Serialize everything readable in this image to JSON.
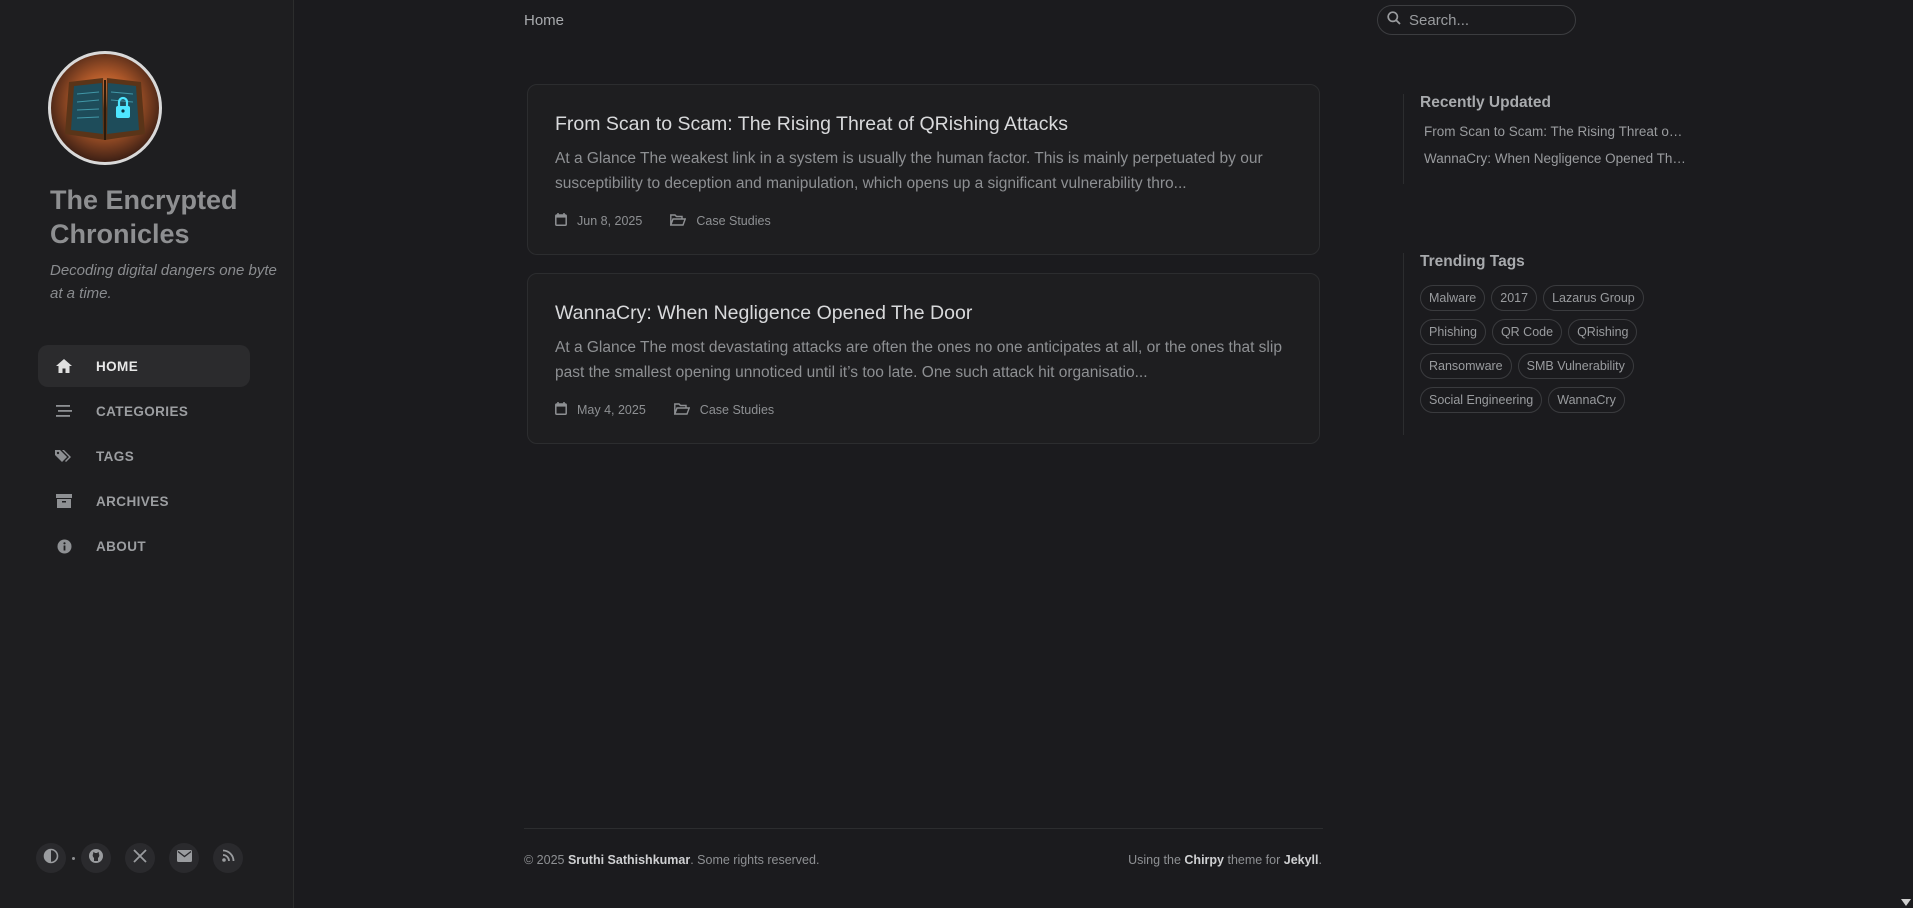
{
  "sidebar": {
    "title": "The Encrypted Chronicles",
    "subtitle": "Decoding digital dangers one byte at a time.",
    "nav": [
      {
        "label": "HOME",
        "icon": "home-icon"
      },
      {
        "label": "CATEGORIES",
        "icon": "stream-icon"
      },
      {
        "label": "TAGS",
        "icon": "tags-icon"
      },
      {
        "label": "ARCHIVES",
        "icon": "archive-icon"
      },
      {
        "label": "ABOUT",
        "icon": "info-icon"
      }
    ],
    "social": [
      "theme-toggle-icon",
      "github-icon",
      "x-twitter-icon",
      "email-icon",
      "rss-icon"
    ]
  },
  "topbar": {
    "breadcrumb": "Home",
    "search_placeholder": "Search..."
  },
  "posts": [
    {
      "title": "From Scan to Scam: The Rising Threat of QRishing Attacks",
      "excerpt": "At a Glance The weakest link in a system is usually the human factor. This is mainly perpetuated by our susceptibility to deception and manipulation, which opens up a significant vulnerability thro...",
      "date": "Jun 8, 2025",
      "category": "Case Studies"
    },
    {
      "title": "WannaCry: When Negligence Opened The Door",
      "excerpt": "At a Glance The most devastating attacks are often the ones no one anticipates at all, or the ones that slip past the smallest opening unnoticed until it’s too late. One such attack hit organisatio...",
      "date": "May 4, 2025",
      "category": "Case Studies"
    }
  ],
  "panel": {
    "recent_title": "Recently Updated",
    "recent": [
      "From Scan to Scam: The Rising Threat of QRishing Attacks",
      "WannaCry: When Negligence Opened The Door"
    ],
    "tags_title": "Trending Tags",
    "tags": [
      "Malware",
      "2017",
      "Lazarus Group",
      "Phishing",
      "QR Code",
      "QRishing",
      "Ransomware",
      "SMB Vulnerability",
      "Social Engineering",
      "WannaCry"
    ]
  },
  "footer": {
    "copyright_prefix": "© 2025 ",
    "author": "Sruthi Sathishkumar",
    "copyright_suffix": ". Some rights reserved.",
    "using": "Using the ",
    "theme": "Chirpy",
    "theme_for": " theme for ",
    "engine": "Jekyll",
    "end": "."
  },
  "colors": {
    "background": "#1b1b1e",
    "sidebar": "#1e1e20",
    "active_nav": "#2b2b2d"
  }
}
